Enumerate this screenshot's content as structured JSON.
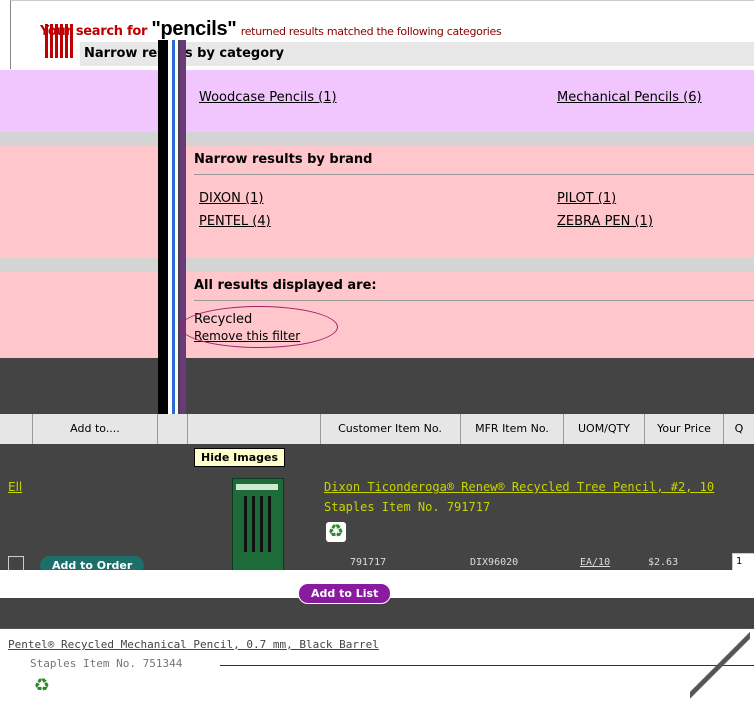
{
  "search": {
    "prefix": "Your search for",
    "term": "\"pencils\"",
    "suffix": "returned results matched the following categories"
  },
  "narrow_category": {
    "title": "Narrow results by category",
    "links": [
      "Woodcase Pencils (1)",
      "Mechanical Pencils (6)"
    ]
  },
  "narrow_brand": {
    "title": "Narrow results by brand",
    "links": [
      "DIXON (1)",
      "PILOT (1)",
      "PENTEL (4)",
      "ZEBRA PEN (1)"
    ]
  },
  "filters": {
    "title": "All results displayed are:",
    "active": "Recycled",
    "remove_label": "Remove this filter"
  },
  "table": {
    "left_headers": [
      "Add to...."
    ],
    "headers": [
      "Customer Item No.",
      "MFR Item No.",
      "UOM/QTY",
      "Your Price",
      "Q"
    ]
  },
  "hide_images_label": "Hide Images",
  "products": [
    {
      "title": "Dixon Ticonderoga® Renew® Recycled Tree Pencil, #2, 10",
      "item_no": "Staples Item No. 791717",
      "customer_item": "791717",
      "mfr_item": "DIX96020",
      "uom": "EA/10",
      "price": "$2.63",
      "qty": "1",
      "add_to_order": "Add to Order",
      "add_to_list": "Add to List",
      "left_link": "Ell"
    },
    {
      "title": "Pentel® Recycled Mechanical Pencil, 0.7 mm, Black Barrel",
      "item_no": "Staples Item No. 751344"
    }
  ],
  "colors": {
    "violet_band": "#f1c6ff",
    "pink_band": "#ffc7cc",
    "grey_band": "#d4d4d4",
    "dark_band": "#444444",
    "title_accent": "#c00000"
  }
}
